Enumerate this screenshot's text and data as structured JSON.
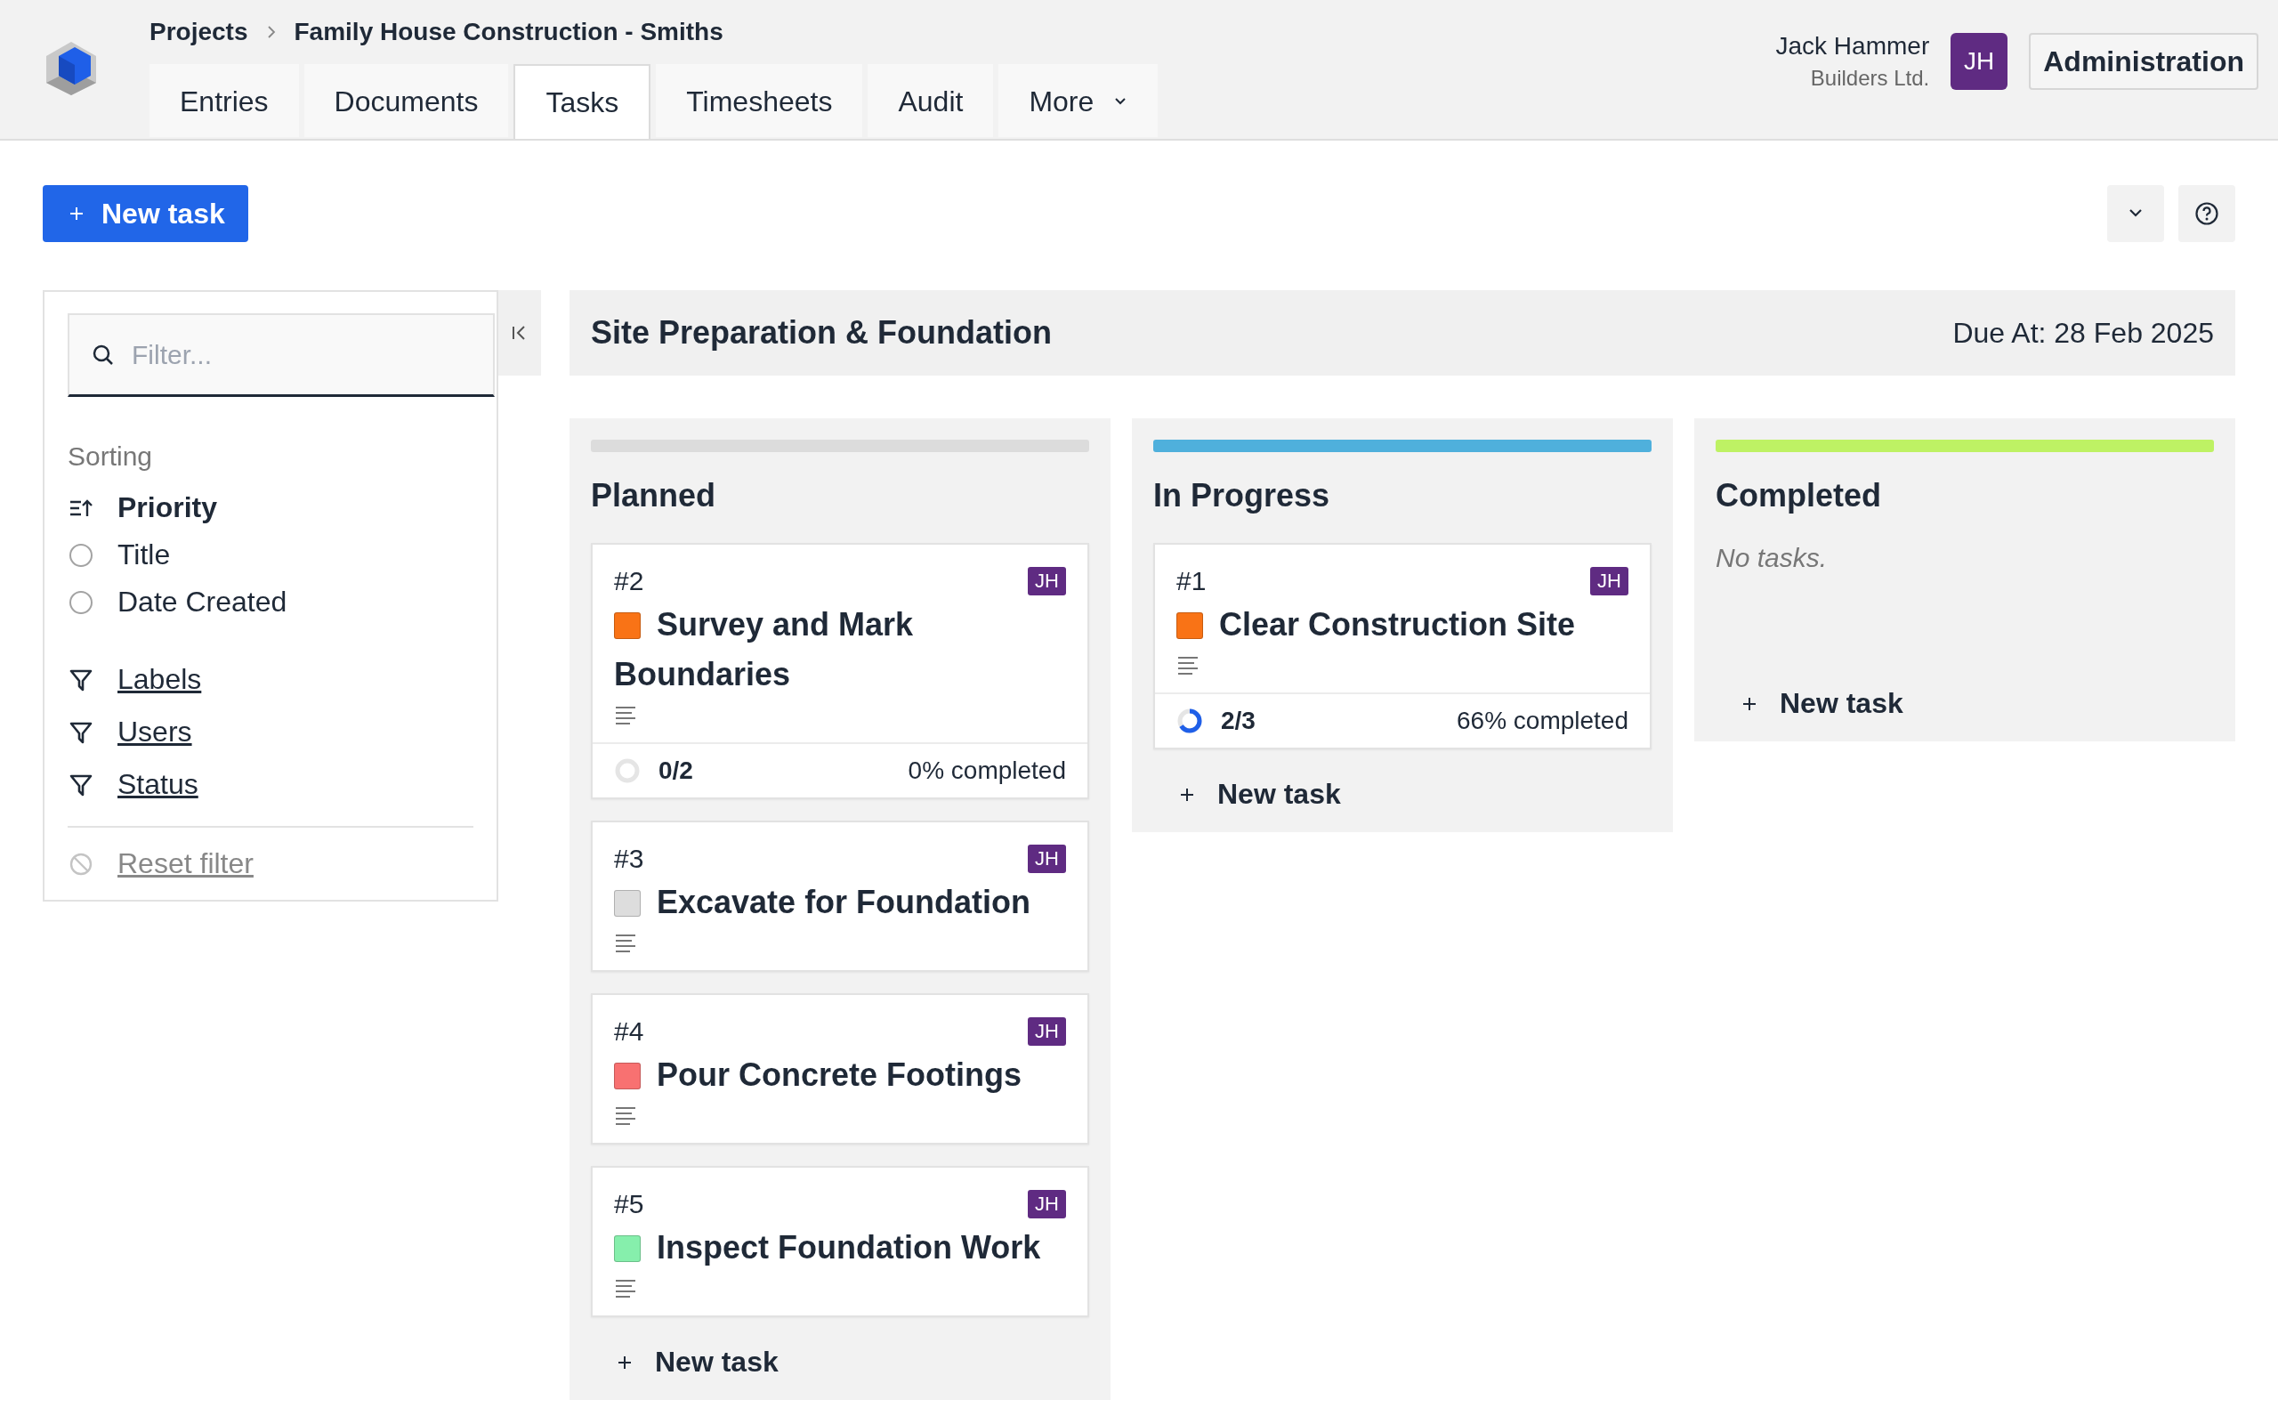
{
  "header": {
    "breadcrumb": [
      "Projects",
      "Family House Construction - Smiths"
    ],
    "tabs": [
      {
        "label": "Entries",
        "selected": false,
        "kind": "link"
      },
      {
        "label": "Documents",
        "selected": false,
        "kind": "link"
      },
      {
        "label": "Tasks",
        "selected": true,
        "kind": "link"
      },
      {
        "label": "Timesheets",
        "selected": false,
        "kind": "link"
      },
      {
        "label": "Audit",
        "selected": false,
        "kind": "link"
      },
      {
        "label": "More",
        "selected": false,
        "kind": "menu"
      }
    ],
    "user": {
      "name": "Jack Hammer",
      "company": "Builders Ltd.",
      "initials": "JH"
    },
    "admin_button": "Administration"
  },
  "toolbar": {
    "new_task_button": "New task"
  },
  "sidebar": {
    "filter": {
      "placeholder": "Filter..."
    },
    "sorting_label": "Sorting",
    "sort_options": [
      {
        "label": "Priority",
        "selected": true
      },
      {
        "label": "Title",
        "selected": false
      },
      {
        "label": "Date Created",
        "selected": false
      }
    ],
    "filters": [
      "Labels",
      "Users",
      "Status"
    ],
    "reset": {
      "label": "Reset filter",
      "disabled": true
    }
  },
  "milestone": {
    "title": "Site Preparation & Foundation",
    "due": "Due At: 28 Feb 2025"
  },
  "columns": [
    {
      "title": "Planned",
      "color": "#dcdcdc",
      "tasks": [
        {
          "number": "#2",
          "assignee": "JH",
          "color": "#f97316",
          "title": "Survey and Mark Boundaries",
          "subtasks": {
            "count": "0/2",
            "progress": "0% completed",
            "level": 0
          }
        },
        {
          "number": "#3",
          "assignee": "JH",
          "color": "#dddddd",
          "title": "Excavate for Foundation"
        },
        {
          "number": "#4",
          "assignee": "JH",
          "color": "#f87171",
          "title": "Pour Concrete Footings"
        },
        {
          "number": "#5",
          "assignee": "JH",
          "color": "#86efac",
          "title": "Inspect Foundation Work"
        }
      ],
      "add_label": "New task"
    },
    {
      "title": "In Progress",
      "color": "#4fb0dc",
      "tasks": [
        {
          "number": "#1",
          "assignee": "JH",
          "color": "#f97316",
          "title": "Clear Construction Site",
          "subtasks": {
            "count": "2/3",
            "progress": "66% completed",
            "level": 0.66
          }
        }
      ],
      "add_label": "New task"
    },
    {
      "title": "Completed",
      "color": "#bef264",
      "empty_text": "No tasks.",
      "add_label": "New task"
    }
  ]
}
